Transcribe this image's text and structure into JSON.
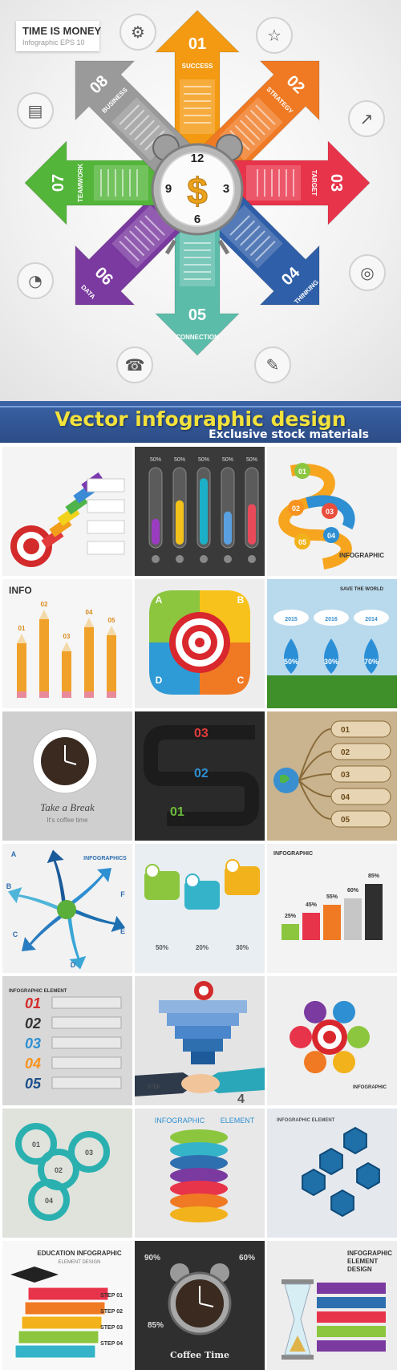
{
  "hero": {
    "title": "TIME IS MONEY",
    "subtitle": "Infographic EPS 10",
    "arrows": [
      {
        "num": "01",
        "label": "SUCCESS",
        "color": "#f39a12"
      },
      {
        "num": "02",
        "label": "STRATEGY",
        "color": "#f07a24"
      },
      {
        "num": "03",
        "label": "TARGET",
        "color": "#e8344a"
      },
      {
        "num": "04",
        "label": "THINKING",
        "color": "#2f5fa8"
      },
      {
        "num": "05",
        "label": "CONNECTION",
        "color": "#5cbcaa"
      },
      {
        "num": "06",
        "label": "DATA",
        "color": "#7b3aa0"
      },
      {
        "num": "07",
        "label": "TEAMWORK",
        "color": "#53b53a"
      },
      {
        "num": "08",
        "label": "BUSINESS",
        "color": "#9a9a9a"
      }
    ],
    "clock_numbers": [
      "12",
      "3",
      "6",
      "9"
    ],
    "icons": [
      "gear-icon",
      "idea-icon",
      "chart-icon",
      "target-icon",
      "pencil-icon",
      "phone-icon",
      "pie-chart-icon",
      "briefcase-icon"
    ]
  },
  "banner": {
    "title": "Vector infographic design",
    "subtitle": "Exclusive stock materials"
  },
  "tiles": [
    {
      "name": "ribbon-target",
      "texts": []
    },
    {
      "name": "test-tubes",
      "texts": [
        "50%",
        "50%",
        "50%",
        "50%",
        "50%"
      ]
    },
    {
      "name": "winding-steps",
      "texts": [
        "01",
        "02",
        "03",
        "04",
        "05",
        "INFOGRAPHIC"
      ]
    },
    {
      "name": "pencils",
      "texts": [
        "INFO",
        "01",
        "02",
        "03",
        "04",
        "05"
      ]
    },
    {
      "name": "target-quadrants",
      "texts": [
        "A",
        "B",
        "C",
        "D"
      ]
    },
    {
      "name": "rain-drops",
      "texts": [
        "2015",
        "2016",
        "2014",
        "50%",
        "30%",
        "70%",
        "SAVE THE WORLD"
      ]
    },
    {
      "name": "coffee-cup",
      "texts": [
        "Take a Break",
        "It's coffee time"
      ]
    },
    {
      "name": "dark-steps",
      "texts": [
        "03",
        "02",
        "01"
      ]
    },
    {
      "name": "globe-branches",
      "texts": [
        "01",
        "02",
        "03",
        "04",
        "05"
      ]
    },
    {
      "name": "spiral-arrows",
      "texts": [
        "INFOGRAPHICS",
        "A",
        "B",
        "C",
        "D",
        "E",
        "F"
      ]
    },
    {
      "name": "speech-markers",
      "texts": [
        "50%",
        "20%",
        "30%"
      ]
    },
    {
      "name": "bar-blocks",
      "texts": [
        "INFOGRAPHIC",
        "25%",
        "45%",
        "55%",
        "60%",
        "85%"
      ]
    },
    {
      "name": "numbered-banners",
      "texts": [
        "INFOGRAPHIC ELEMENT",
        "01",
        "02",
        "03",
        "04",
        "05"
      ]
    },
    {
      "name": "handshake-stairs",
      "texts": [
        "4",
        "STEP"
      ]
    },
    {
      "name": "target-petals",
      "texts": [
        "INFOGRAPHIC"
      ]
    },
    {
      "name": "rings",
      "texts": [
        "01",
        "02",
        "03",
        "04"
      ]
    },
    {
      "name": "color-stack",
      "texts": [
        "INFOGRAPHIC",
        "ELEMENT"
      ]
    },
    {
      "name": "hexagons",
      "texts": [
        "INFOGRAPHIC ELEMENT"
      ]
    },
    {
      "name": "books",
      "texts": [
        "EDUCATION INFOGRAPHIC",
        "ELEMENT DESIGN",
        "STEP 01",
        "STEP 02",
        "STEP 03",
        "STEP 04"
      ]
    },
    {
      "name": "alarm-clock",
      "texts": [
        "90%",
        "60%",
        "85%",
        "Coffee Time"
      ]
    },
    {
      "name": "hourglass",
      "texts": [
        "INFOGRAPHIC",
        "ELEMENT",
        "DESIGN"
      ]
    }
  ]
}
